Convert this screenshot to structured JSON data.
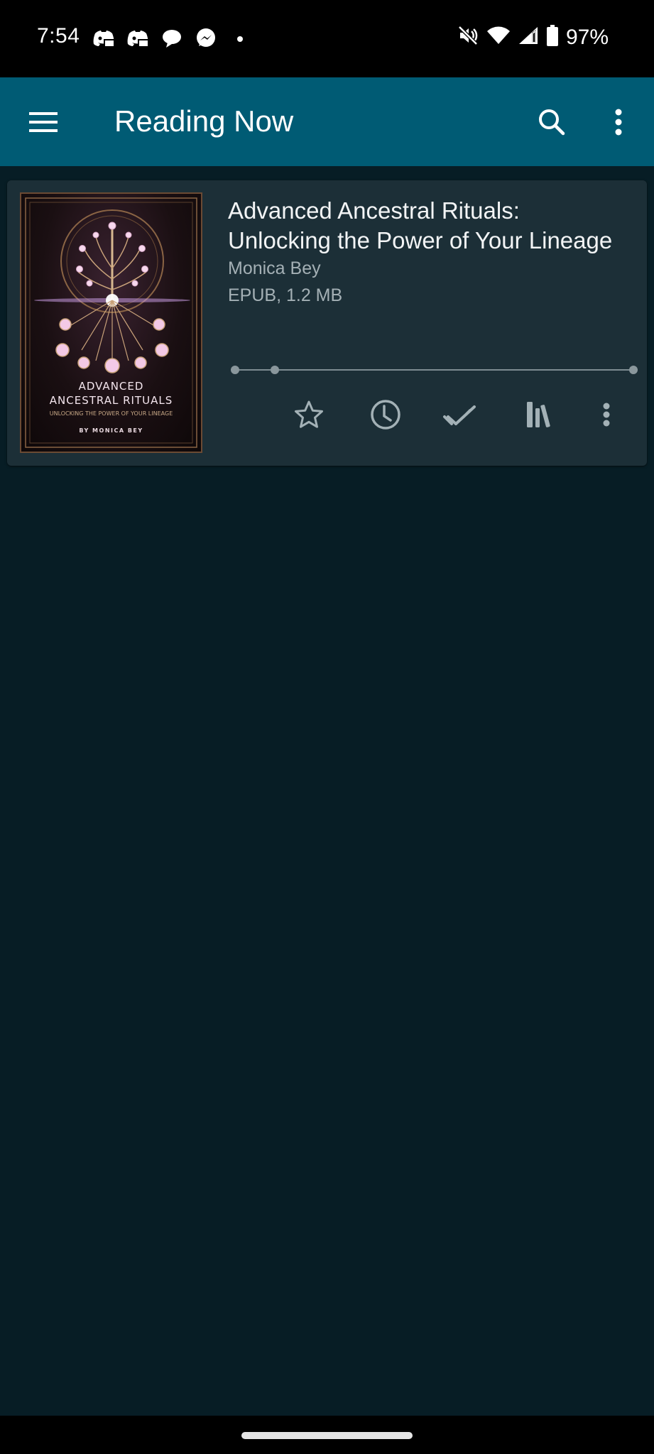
{
  "status_bar": {
    "time": "7:54",
    "notification_icons": [
      "discord-icon",
      "discord-icon",
      "chat-bubble-icon",
      "messenger-icon",
      "more-notifications-dot"
    ],
    "system_icons": [
      "mute-icon",
      "wifi-icon",
      "cellular-signal-icon",
      "battery-icon"
    ],
    "battery_percent": "97%"
  },
  "app_bar": {
    "title": "Reading Now",
    "menu_icon": "hamburger-menu-icon",
    "search_icon": "search-icon",
    "more_icon": "more-vert-icon"
  },
  "books": [
    {
      "title_line1": "Advanced Ancestral Rituals:",
      "title_line2": "Unlocking the Power of Your Lineage",
      "author": "Monica Bey",
      "format": "EPUB, 1.2 MB",
      "progress_fraction": 0.1,
      "cover": {
        "title1": "ADVANCED",
        "title2": "ANCESTRAL RITUALS",
        "subtitle": "UNLOCKING THE POWER OF YOUR LINEAGE",
        "author": "BY MONICA BEY"
      },
      "actions": [
        {
          "name": "favorite",
          "icon": "star-outline-icon"
        },
        {
          "name": "reading-history",
          "icon": "clock-icon"
        },
        {
          "name": "mark-as-read",
          "icon": "double-check-icon"
        },
        {
          "name": "collections",
          "icon": "bookshelf-icon"
        },
        {
          "name": "more",
          "icon": "more-vert-icon"
        }
      ]
    }
  ],
  "colors": {
    "app_bar": "#005b74",
    "background": "#071d25",
    "card": "#1c2f37",
    "icon_muted": "#a3b1b6"
  }
}
